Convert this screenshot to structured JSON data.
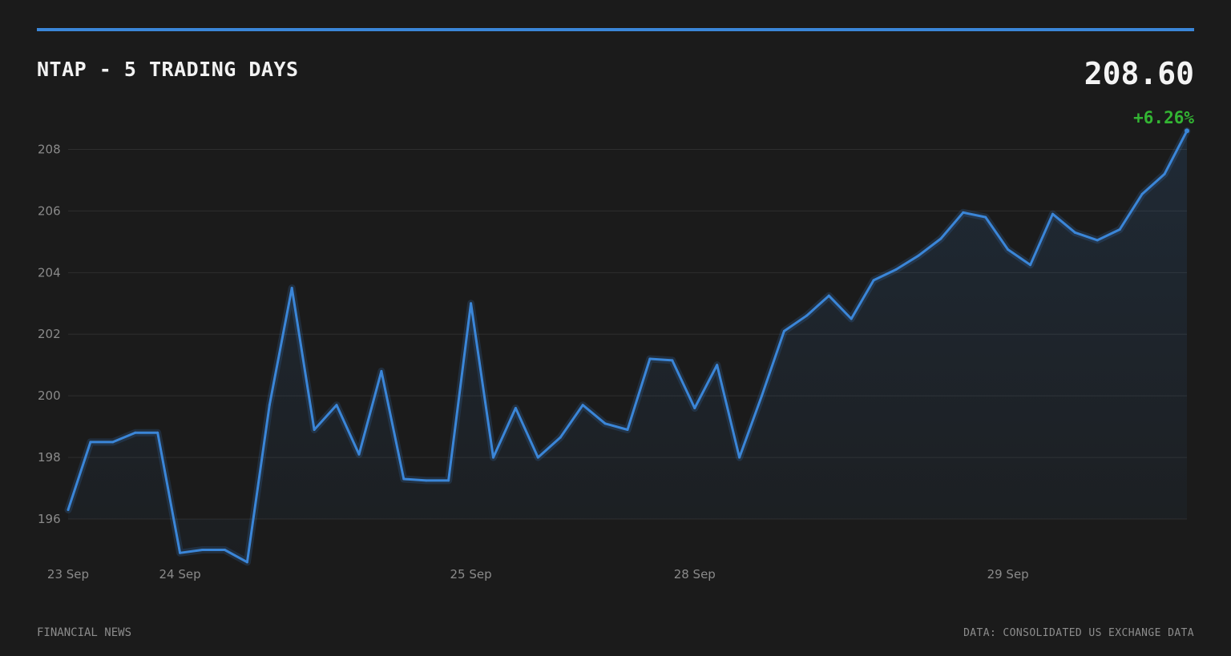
{
  "header": {
    "title": "NTAP - 5 TRADING DAYS",
    "price": "208.60",
    "change": "+6.26%"
  },
  "footer": {
    "source_left": "FINANCIAL NEWS",
    "source_right": "DATA: CONSOLIDATED US EXCHANGE DATA"
  },
  "colors": {
    "background": "#1b1b1b",
    "accent": "#3b86d8",
    "positive": "#33b533"
  },
  "chart_data": {
    "type": "area",
    "title": "NTAP - 5 TRADING DAYS",
    "xlabel": "",
    "ylabel": "",
    "ylim": [
      194.6,
      208.6
    ],
    "yticks": [
      196,
      198,
      200,
      202,
      204,
      206,
      208
    ],
    "grid": true,
    "xticks": [
      {
        "index": 0,
        "label": "23 Sep"
      },
      {
        "index": 5,
        "label": "24 Sep"
      },
      {
        "index": 18,
        "label": "25 Sep"
      },
      {
        "index": 28,
        "label": "28 Sep"
      },
      {
        "index": 42,
        "label": "29 Sep"
      }
    ],
    "series": [
      {
        "values": [
          196.3,
          198.5,
          198.5,
          198.8,
          198.8,
          194.9,
          195.0,
          195.0,
          194.6,
          199.7,
          203.5,
          198.9,
          199.7,
          198.1,
          200.8,
          197.3,
          197.25,
          197.25,
          203.0,
          198.0,
          199.6,
          198.0,
          198.65,
          199.7,
          199.1,
          198.9,
          201.2,
          201.15,
          199.6,
          201.0,
          198.0,
          200.0,
          202.1,
          202.6,
          203.25,
          202.5,
          203.75,
          204.1,
          204.55,
          205.1,
          205.95,
          205.8,
          204.75,
          204.25,
          205.9,
          205.3,
          205.05,
          205.4,
          206.55,
          207.2,
          208.6
        ]
      }
    ]
  }
}
